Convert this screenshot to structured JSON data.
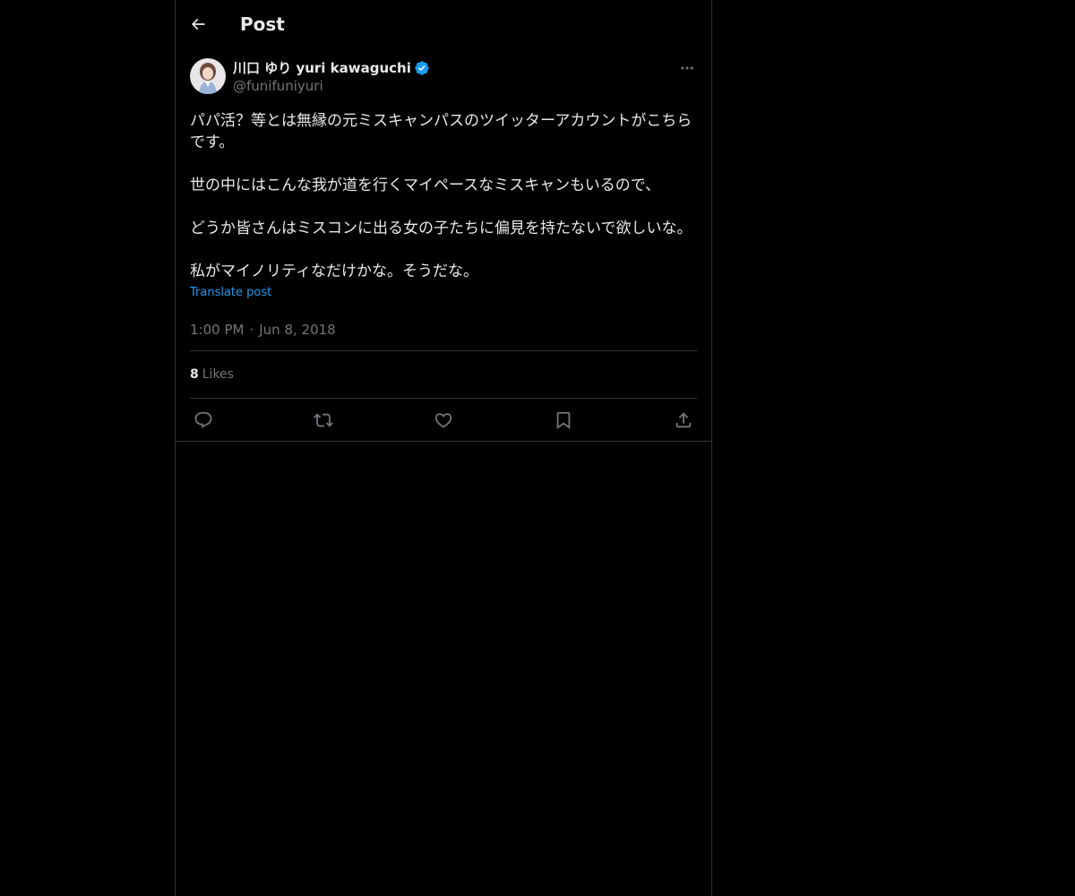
{
  "header": {
    "title": "Post"
  },
  "author": {
    "display_name": "川口 ゆり yuri kawaguchi",
    "handle": "@funifuniyuri",
    "verified": true
  },
  "post": {
    "paragraphs": [
      "パパ活？等とは無縁の元ミスキャンパスのツイッターアカウントがこちらです。",
      "世の中にはこんな我が道を行くマイペースなミスキャンもいるので、",
      "どうか皆さんはミスコンに出る女の子たちに偏見を持たないで欲しいな。",
      "私がマイノリティなだけかな。そうだな。"
    ],
    "translate_label": "Translate post",
    "time": "1:00 PM",
    "separator": "·",
    "date": "Jun 8, 2018"
  },
  "stats": {
    "likes_count": "8",
    "likes_label": "Likes"
  },
  "colors": {
    "background": "#000000",
    "border": "#2f3336",
    "text": "#e7e9ea",
    "muted": "#71767b",
    "accent": "#1d9bf0"
  },
  "icons": {
    "back": "arrow-left-icon",
    "verified": "verified-badge-icon",
    "more": "more-horizontal-icon",
    "reply": "reply-icon",
    "repost": "repost-icon",
    "like": "heart-icon",
    "bookmark": "bookmark-icon",
    "share": "share-icon"
  }
}
